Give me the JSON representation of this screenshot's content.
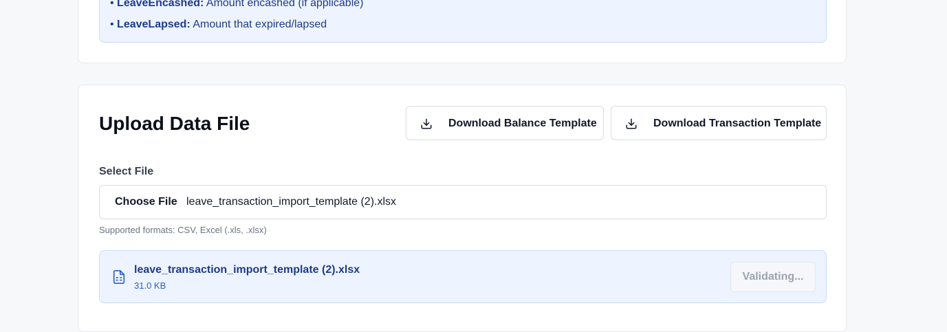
{
  "info": {
    "items": [
      {
        "key": "LeaveEncashed:",
        "desc": " Amount encashed (if applicable)"
      },
      {
        "key": "LeaveLapsed:",
        "desc": " Amount that expired/lapsed"
      }
    ]
  },
  "upload": {
    "title": "Upload Data File",
    "download_balance_label": "Download Balance Template",
    "download_transaction_label": "Download Transaction Template",
    "select_label": "Select File",
    "choose_button": "Choose File",
    "chosen_file": "leave_transaction_import_template (2).xlsx",
    "hint": "Supported formats: CSV, Excel (.xls, .xlsx)",
    "file": {
      "name": "leave_transaction_import_template (2).xlsx",
      "size": "31.0 KB",
      "status_button": "Validating..."
    }
  },
  "colors": {
    "accent": "#1e3a8a",
    "info_bg": "#eef4ff",
    "info_border": "#c7dbf8"
  },
  "icons": {
    "download": "download-icon",
    "file": "spreadsheet-file-icon"
  }
}
